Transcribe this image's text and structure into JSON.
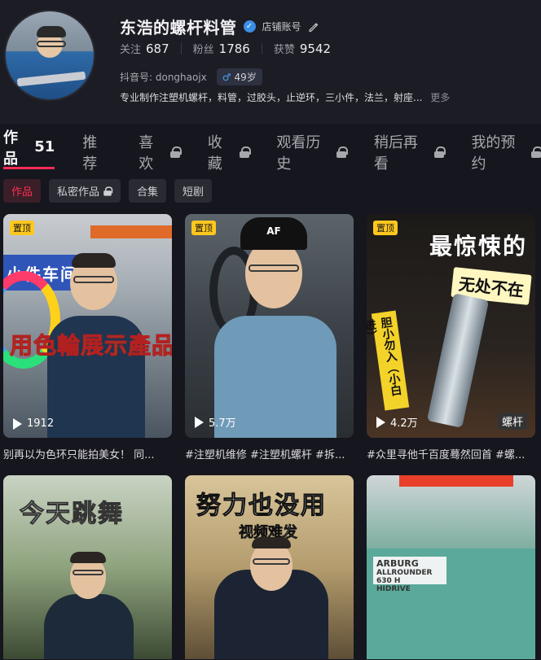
{
  "profile": {
    "name": "东浩的螺杆料管",
    "store_label": "店铺账号",
    "stats": [
      {
        "label": "关注",
        "value": "687"
      },
      {
        "label": "粉丝",
        "value": "1786"
      },
      {
        "label": "获赞",
        "value": "9542"
      }
    ],
    "douyin_id": "抖音号: donghaojx",
    "age": "49岁",
    "bio": "专业制作注塑机螺杆，料管，过胶头，止逆环，三小件，法兰，射座...",
    "bio_more": "更多"
  },
  "tabs": [
    {
      "label": "作品",
      "count": "51",
      "locked": false,
      "active": true
    },
    {
      "label": "推荐",
      "locked": false,
      "active": false
    },
    {
      "label": "喜欢",
      "locked": true,
      "active": false
    },
    {
      "label": "收藏",
      "locked": true,
      "active": false
    },
    {
      "label": "观看历史",
      "locked": true,
      "active": false
    },
    {
      "label": "稍后再看",
      "locked": true,
      "active": false
    },
    {
      "label": "我的预约",
      "locked": true,
      "active": false
    }
  ],
  "subtabs": [
    {
      "label": "作品",
      "active": true,
      "locked": false
    },
    {
      "label": "私密作品",
      "active": false,
      "locked": true
    },
    {
      "label": "合集",
      "active": false,
      "locked": false
    },
    {
      "label": "短剧",
      "active": false,
      "locked": false
    }
  ],
  "videos": [
    {
      "pinned": "置顶",
      "plays": "1912",
      "caption": "别再以为色环只能拍美女！ 同...",
      "overlay": [
        "小件车间",
        "用色輪展示產品"
      ]
    },
    {
      "pinned": "置顶",
      "plays": "5.7万",
      "caption": "#注塑机维修 #注塑机螺杆 #拆...",
      "overlay": [
        "AF"
      ]
    },
    {
      "pinned": "置顶",
      "plays": "4.2万",
      "caption": "#众里寻他千百度蓦然回首 #螺...",
      "overlay": [
        "最惊悚的",
        "无处不在",
        "胆小勿入（小白进）",
        "螺杆"
      ]
    },
    {
      "pinned": "",
      "plays": "",
      "caption": "",
      "overlay": [
        "今天跳舞"
      ]
    },
    {
      "pinned": "",
      "plays": "",
      "caption": "",
      "overlay": [
        "努力也没用",
        "视频难发"
      ]
    },
    {
      "pinned": "",
      "plays": "",
      "caption": "",
      "overlay": [
        "ARBURG",
        "ALLROUNDER 630 H",
        "HIDRIVE"
      ]
    }
  ],
  "icons": {
    "verify": "verified-icon",
    "edit": "edit-icon",
    "male": "male-icon",
    "lock": "lock-icon",
    "play": "play-icon"
  },
  "colors": {
    "accent": "#fe2c55",
    "pin": "#fdc81e",
    "verify": "#3a8ee6"
  }
}
